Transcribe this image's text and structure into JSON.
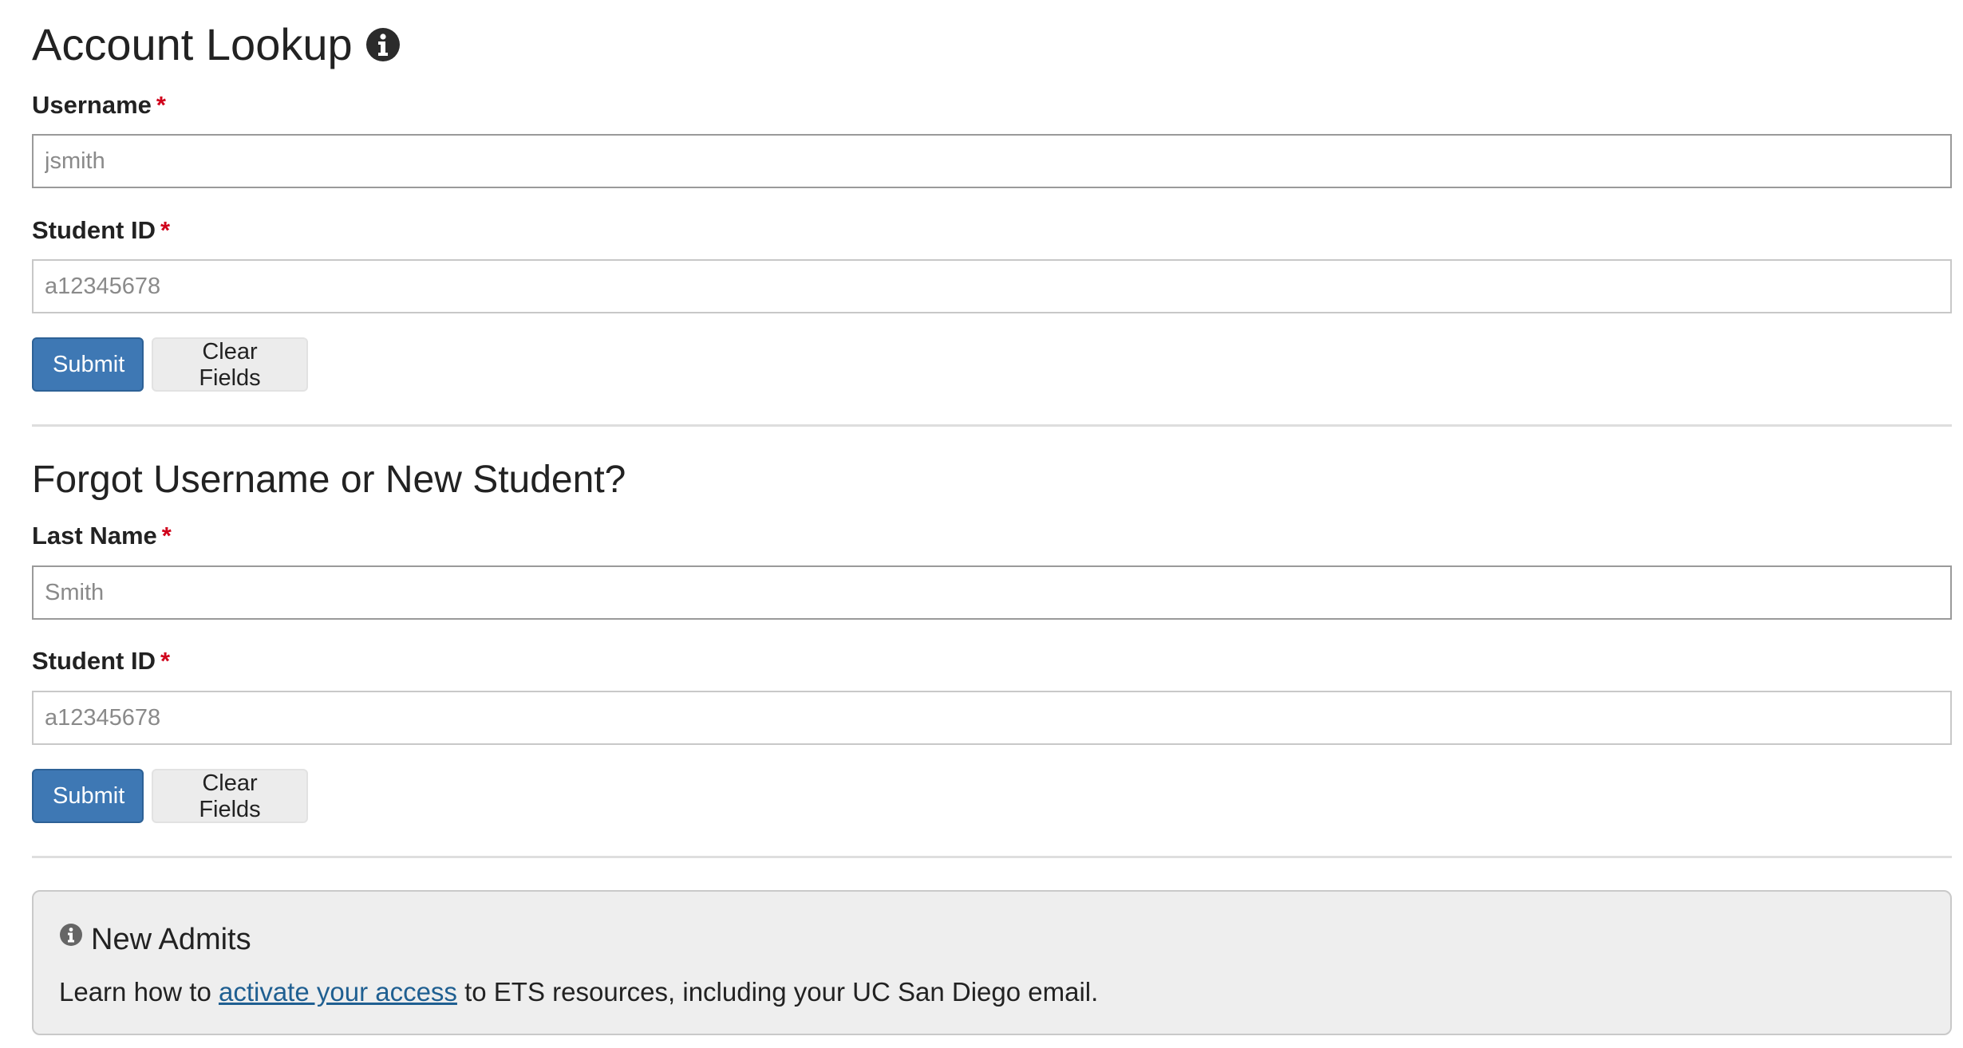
{
  "account_lookup": {
    "title": "Account Lookup",
    "info_icon": "info-circle-icon",
    "username": {
      "label": "Username",
      "required_mark": "*",
      "placeholder": "jsmith",
      "value": ""
    },
    "student_id": {
      "label": "Student ID",
      "required_mark": "*",
      "placeholder": "a12345678",
      "value": ""
    },
    "submit_label": "Submit",
    "clear_label": "Clear Fields"
  },
  "forgot_username": {
    "title": "Forgot Username or New Student?",
    "last_name": {
      "label": "Last Name",
      "required_mark": "*",
      "placeholder": "Smith",
      "value": ""
    },
    "student_id": {
      "label": "Student ID",
      "required_mark": "*",
      "placeholder": "a12345678",
      "value": ""
    },
    "submit_label": "Submit",
    "clear_label": "Clear Fields"
  },
  "new_admits": {
    "icon": "info-circle-icon",
    "title": "New Admits",
    "text_before": "Learn how to ",
    "link_text": "activate your access",
    "text_after": " to ETS resources, including your UC San Diego email."
  },
  "colors": {
    "primary_button": "#3e78b4",
    "required_mark": "#d0021b",
    "link": "#1f5f91",
    "notice_background": "#eeeeee"
  }
}
